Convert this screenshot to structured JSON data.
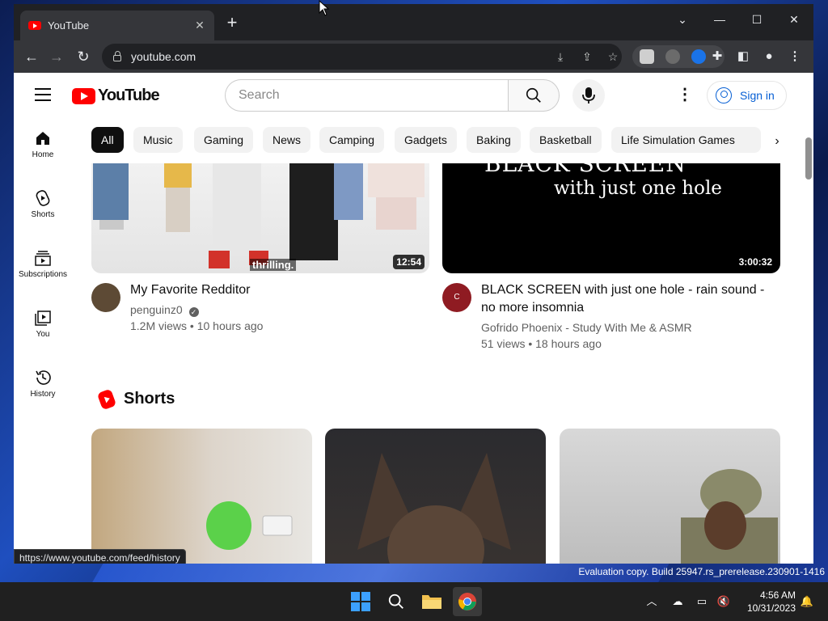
{
  "browser": {
    "tab_title": "YouTube",
    "url": "youtube.com",
    "status_url": "https://www.youtube.com/feed/history"
  },
  "masthead": {
    "logo_text": "YouTube",
    "search_placeholder": "Search",
    "signin_label": "Sign in"
  },
  "guide": [
    {
      "label": "Home",
      "icon": "home-icon"
    },
    {
      "label": "Shorts",
      "icon": "shorts-icon"
    },
    {
      "label": "Subscriptions",
      "icon": "subscriptions-icon"
    },
    {
      "label": "You",
      "icon": "you-icon"
    },
    {
      "label": "History",
      "icon": "history-icon"
    }
  ],
  "chips": [
    "All",
    "Music",
    "Gaming",
    "News",
    "Camping",
    "Gadgets",
    "Baking",
    "Basketball",
    "Life Simulation Games"
  ],
  "videos": [
    {
      "title": "My Favorite Redditor",
      "channel": "penguinz0",
      "meta": "1.2M views • 10 hours ago",
      "duration": "12:54",
      "caption": "thrilling."
    },
    {
      "title": "BLACK SCREEN with just one hole - rain sound - no more insomnia",
      "channel": "Gofrido Phoenix - Study With Me & ASMR",
      "meta": "51 views • 18 hours ago",
      "duration": "3:00:32",
      "thumb_text_1": "BLACK SCREEN",
      "thumb_text_2": "with just one hole"
    }
  ],
  "shorts_heading": "Shorts",
  "desktop": {
    "eval_text": "Evaluation copy. Build 25947.rs_prerelease.230901-1416",
    "time": "4:56 AM",
    "date": "10/31/2023"
  },
  "colors": {
    "youtube_red": "#ff0000",
    "link_blue": "#065fd4",
    "chrome_dark": "#202124"
  }
}
